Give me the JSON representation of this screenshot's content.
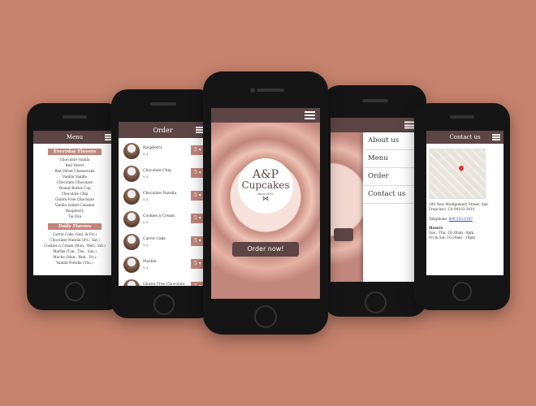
{
  "phone_menu": {
    "title": "Menu",
    "everyday_heading": "Everyday Flavors",
    "everyday": [
      "Chocolate Vanilla",
      "Red Velvet",
      "Red Velvet Cheesecake",
      "Vanilla Vanilla",
      "Chocolate Chocolate",
      "Peanut Butter Cup",
      "Chocolate Chip",
      "Gluten Free Chocolate",
      "Vanilla Salted Caramel",
      "Raspberry",
      "Tie Dye"
    ],
    "daily_heading": "Daily Flavors",
    "daily": [
      "Carrot Cake (Sun. & Fri.)",
      "Chocolate Nutella (Fri., Sat.)",
      "Cookies n Cream (Mon., Wed., Sat.)",
      "Marble (Tue., Thu., Sun.)",
      "Mocha (Mon., Wed., Fri.)",
      "Vanilla Nutella (Thu.)"
    ]
  },
  "phone_order": {
    "title": "Order",
    "items": [
      {
        "name": "Raspberry",
        "price": "$ 4",
        "qty": "5"
      },
      {
        "name": "Chocolate Chip",
        "price": "$ 4",
        "qty": "5"
      },
      {
        "name": "Chocolate Nutella",
        "price": "$ 4",
        "qty": "5"
      },
      {
        "name": "Cookies n Cream",
        "price": "$ 4",
        "qty": "5"
      },
      {
        "name": "Carrot Cake",
        "price": "$ 4",
        "qty": "5"
      },
      {
        "name": "Marble",
        "price": "$ 4",
        "qty": "5"
      },
      {
        "name": "Gluten Free Chocolate",
        "price": "",
        "qty": "5"
      }
    ]
  },
  "phone_home": {
    "logo_line1": "A&P",
    "logo_line2": "Cupcakes",
    "logo_since": "since 2013",
    "order_button": "Order now!"
  },
  "phone_nav": {
    "items": [
      "About us",
      "Menu",
      "Order",
      "Contact us"
    ]
  },
  "phone_contact": {
    "title": "Contact us",
    "address": "280 New Montgomery Street, San Francisco, CA 94103-3410",
    "telephone_label": "Telephone:",
    "telephone": "800.555.0187",
    "hours_heading": "Hours",
    "hours_line1": "Sun - Thu: 10:30am - 8pm",
    "hours_line2": "Fri & Sat: 10:30am - 10pm"
  },
  "colors": {
    "background": "#c5826c",
    "header": "#5d4545",
    "accent": "#c1867c"
  }
}
